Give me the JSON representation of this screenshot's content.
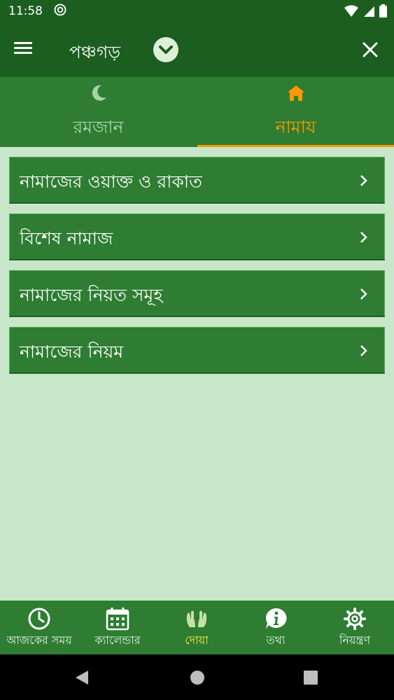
{
  "status_bar": {
    "time": "11:58"
  },
  "app_bar": {
    "title": "পঞ্চগড়"
  },
  "tabs": [
    {
      "label": "রমজান",
      "icon": "moon-icon",
      "active": false
    },
    {
      "label": "নামায",
      "icon": "home-icon",
      "active": true
    }
  ],
  "list_items": [
    {
      "label": "নামাজের ওয়াক্ত ও রাকাত"
    },
    {
      "label": "বিশেষ নামাজ"
    },
    {
      "label": "নামাজের নিয়ত সমূহ"
    },
    {
      "label": "নামাজের নিয়ম"
    }
  ],
  "bottom_nav": [
    {
      "label": "আজকের সময়",
      "icon": "clock-icon",
      "active": false
    },
    {
      "label": "ক্যালেন্ডার",
      "icon": "calendar-icon",
      "active": false
    },
    {
      "label": "দোয়া",
      "icon": "praying-hands-icon",
      "active": true
    },
    {
      "label": "তথ্য",
      "icon": "info-icon",
      "active": false
    },
    {
      "label": "নিয়ন্ত্রণ",
      "icon": "gear-icon",
      "active": false
    }
  ],
  "colors": {
    "primary_dark": "#1b5e20",
    "primary": "#2e7d32",
    "background": "#c8e6c9",
    "accent": "#ff9800",
    "active_nav": "#ffeb3b"
  }
}
